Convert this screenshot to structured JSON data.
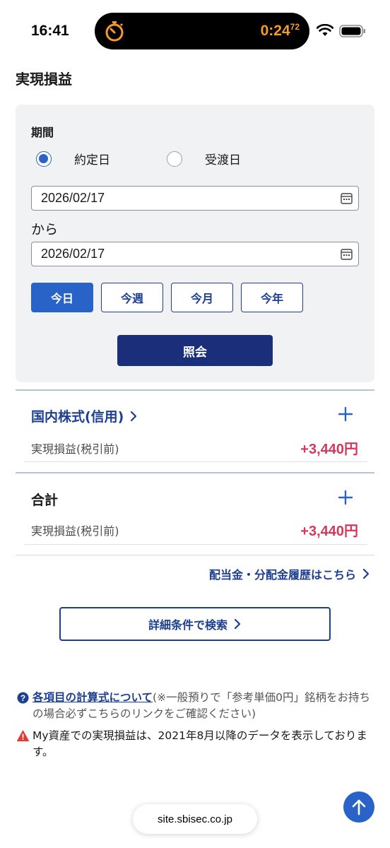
{
  "status_bar": {
    "time": "16:41",
    "timer_main": "0:24",
    "timer_sub": "72",
    "timer_color": "#f39a31"
  },
  "page": {
    "title": "実現損益"
  },
  "filter": {
    "period_label": "期間",
    "radio_options": [
      {
        "label": "約定日",
        "checked": true
      },
      {
        "label": "受渡日",
        "checked": false
      }
    ],
    "date_from": "2026/02/17",
    "separator": "から",
    "date_to": "2026/02/17",
    "quick_buttons": [
      {
        "label": "今日",
        "active": true
      },
      {
        "label": "今週",
        "active": false
      },
      {
        "label": "今月",
        "active": false
      },
      {
        "label": "今年",
        "active": false
      }
    ],
    "query_button": "照会"
  },
  "sections": [
    {
      "title": "国内株式(信用)",
      "is_link": true,
      "row_label": "実現損益(税引前)",
      "row_value": "+3,440円"
    },
    {
      "title": "合計",
      "is_link": false,
      "row_label": "実現損益(税引前)",
      "row_value": "+3,440円"
    }
  ],
  "links": {
    "dividend_history": "配当金・分配金履歴はこちら",
    "detail_search": "詳細条件で検索"
  },
  "notes": {
    "formula_link": "各項目の計算式について",
    "formula_paren": "(※一般預りで「参考単価0円」銘柄をお持ちの場合必ずこちらのリンクをご確認ください)",
    "warning": "My資産での実現損益は、2021年8月以降のデータを表示しております。"
  },
  "browser": {
    "url": "site.sbisec.co.jp"
  },
  "colors": {
    "accent_blue": "#2a63c7",
    "navy": "#1a2e7a",
    "link_navy": "#1d3f8f",
    "profit_red": "#d13a5c",
    "warning_red": "#e53935"
  },
  "icons": {
    "timer": "stopwatch-icon",
    "calendar": "calendar-icon",
    "expand": "plus-icon",
    "chevron": "chevron-right-icon",
    "help": "question-circle-icon",
    "warning": "warning-triangle-icon",
    "scroll_top": "arrow-up-icon"
  }
}
